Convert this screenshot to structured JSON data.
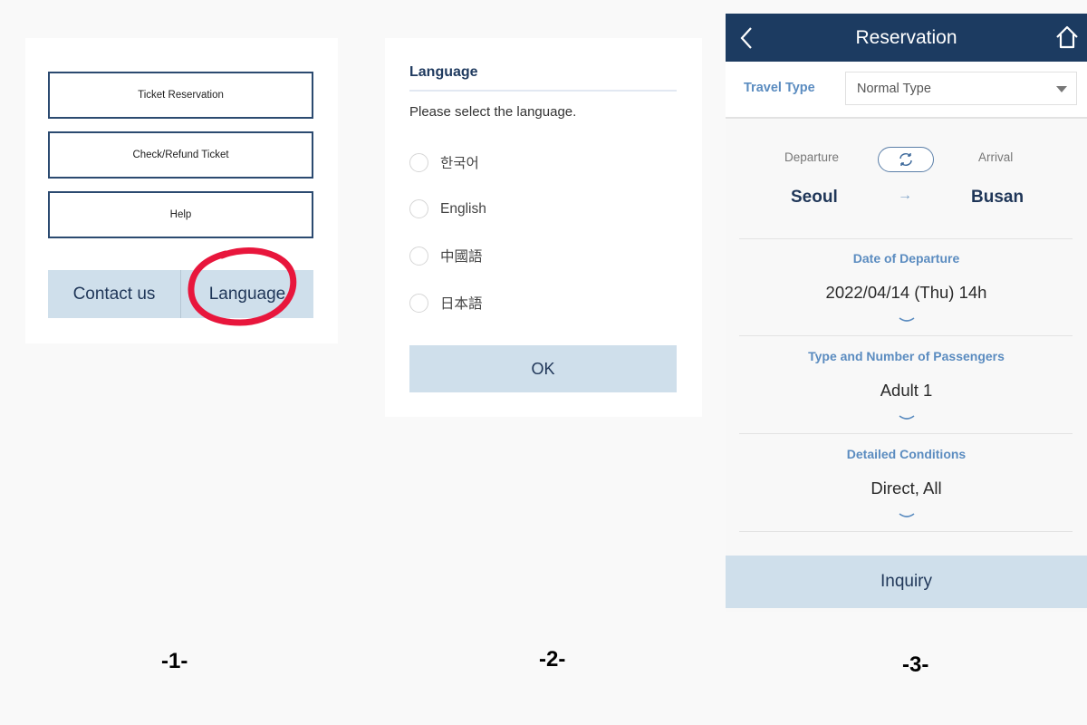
{
  "panel1": {
    "menu_items": [
      "Ticket Reservation",
      "Check/Refund Ticket",
      "Help"
    ],
    "contact_label": "Contact us",
    "language_label": "Language",
    "annotation": "red-circle-highlight"
  },
  "panel2": {
    "title": "Language",
    "prompt": "Please select the language.",
    "options": [
      {
        "label": "한국어",
        "selected": false
      },
      {
        "label": "English",
        "selected": false
      },
      {
        "label": "中國語",
        "selected": false
      },
      {
        "label": "日本語",
        "selected": false
      }
    ],
    "ok_label": "OK"
  },
  "panel3": {
    "header_title": "Reservation",
    "icons": {
      "back": "chevron-left-icon",
      "home": "home-icon",
      "swap": "swap-icon",
      "arrow": "arrow-right-icon"
    },
    "travel_type_label": "Travel Type",
    "travel_type_value": "Normal Type",
    "departure_label": "Departure",
    "arrival_label": "Arrival",
    "departure_value": "Seoul",
    "arrival_value": "Busan",
    "sections": [
      {
        "title": "Date of Departure",
        "value": "2022/04/14 (Thu) 14h"
      },
      {
        "title": "Type and Number of Passengers",
        "value": "Adult 1"
      },
      {
        "title": "Detailed Conditions",
        "value": "Direct, All"
      }
    ],
    "inquiry_label": "Inquiry"
  },
  "figure_labels": [
    "-1-",
    "-2-",
    "-3-"
  ],
  "colors": {
    "navy": "#1c3b61",
    "accent_blue": "#5b8cc0",
    "button_bg": "#cfdfeb",
    "highlight_red": "#e8163c"
  }
}
